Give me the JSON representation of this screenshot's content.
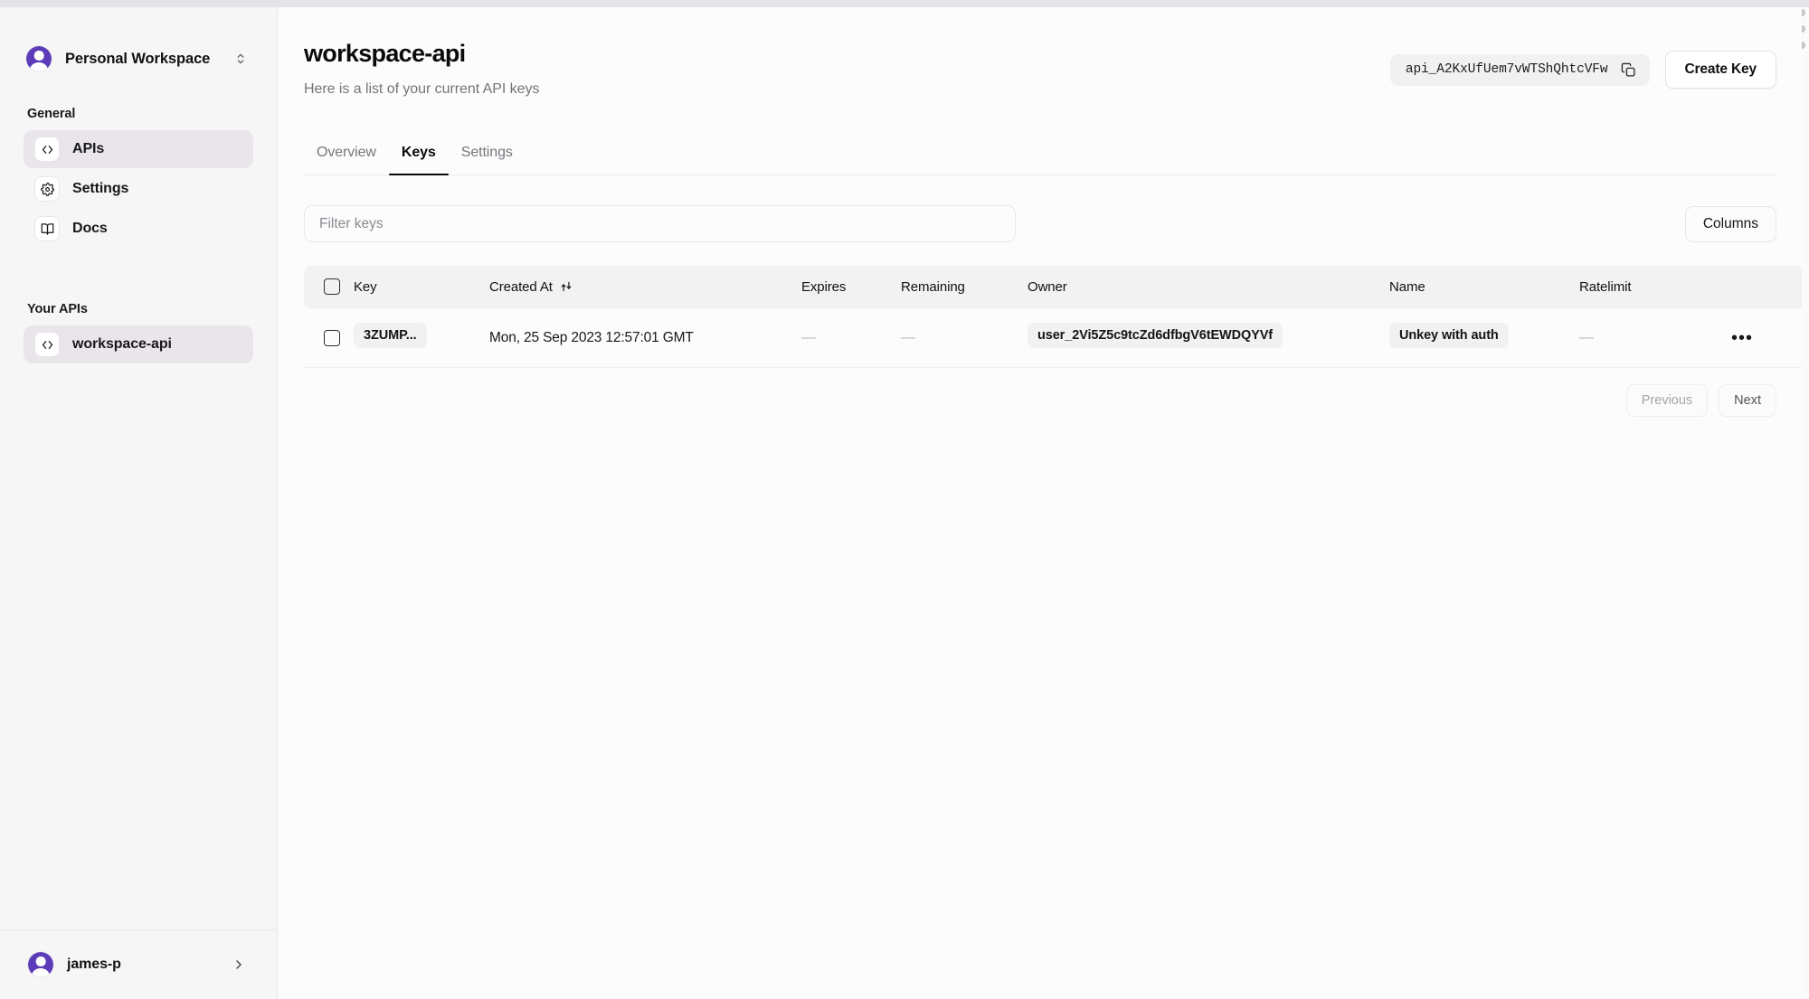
{
  "sidebar": {
    "workspace": {
      "name": "Personal Workspace",
      "switcher_icon": "chevron-up-down-icon"
    },
    "general_label": "General",
    "general_items": [
      {
        "label": "APIs",
        "icon": "code-brackets-icon",
        "active": true
      },
      {
        "label": "Settings",
        "icon": "gear-icon",
        "active": false
      },
      {
        "label": "Docs",
        "icon": "book-open-icon",
        "active": false
      }
    ],
    "your_apis_label": "Your APIs",
    "api_items": [
      {
        "label": "workspace-api",
        "icon": "code-brackets-icon",
        "active": true
      }
    ],
    "user": {
      "name": "james-p",
      "chevron_icon": "chevron-right-icon"
    }
  },
  "header": {
    "title": "workspace-api",
    "subtitle": "Here is a list of your current API keys",
    "api_id": "api_A2KxUfUem7vWTShQhtcVFw",
    "copy_icon": "copy-icon",
    "create_key_label": "Create Key"
  },
  "tabs": [
    {
      "label": "Overview",
      "active": false
    },
    {
      "label": "Keys",
      "active": true
    },
    {
      "label": "Settings",
      "active": false
    }
  ],
  "toolbar": {
    "filter_placeholder": "Filter keys",
    "filter_value": "",
    "columns_label": "Columns"
  },
  "table": {
    "columns": [
      "Key",
      "Created At",
      "Expires",
      "Remaining",
      "Owner",
      "Name",
      "Ratelimit"
    ],
    "sort_icon": "sort-updown-icon",
    "rows": [
      {
        "key": "3ZUMP...",
        "created_at": "Mon, 25 Sep 2023 12:57:01 GMT",
        "expires": "—",
        "remaining": "—",
        "owner": "user_2Vi5Z5c9tcZd6dfbgV6tEWDQYVf",
        "name": "Unkey with auth",
        "ratelimit": "—",
        "menu_icon": "ellipsis-icon",
        "menu_label": "•••"
      }
    ]
  },
  "pagination": {
    "previous_label": "Previous",
    "next_label": "Next"
  },
  "colors": {
    "accent": "#5b3bb8",
    "sidebar_bg": "#f6f6f7",
    "main_bg": "#fcfcfc",
    "active_nav": "#e9e5ea"
  }
}
